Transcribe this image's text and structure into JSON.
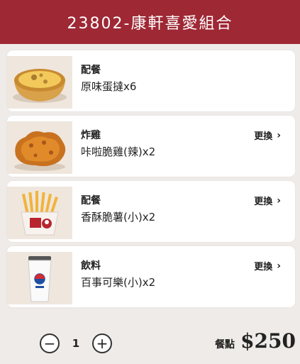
{
  "header": {
    "title": "23802-康軒喜愛組合"
  },
  "items": [
    {
      "category": "配餐",
      "name": "原味蛋撻x6",
      "change_label": "",
      "image_icon": "egg-tart-image"
    },
    {
      "category": "炸雞",
      "name": "咔啦脆雞(辣)x2",
      "change_label": "更換",
      "image_icon": "fried-chicken-image"
    },
    {
      "category": "配餐",
      "name": "香酥脆薯(小)x2",
      "change_label": "更換",
      "image_icon": "french-fries-image"
    },
    {
      "category": "飲料",
      "name": "百事可樂(小)x2",
      "change_label": "更換",
      "image_icon": "pepsi-cup-image"
    }
  ],
  "quantity": {
    "value": "1",
    "minus": "−",
    "plus": "+"
  },
  "price": {
    "label": "餐點",
    "amount": "$250"
  },
  "colors": {
    "header": "#9e2834",
    "background": "#efebe8"
  }
}
